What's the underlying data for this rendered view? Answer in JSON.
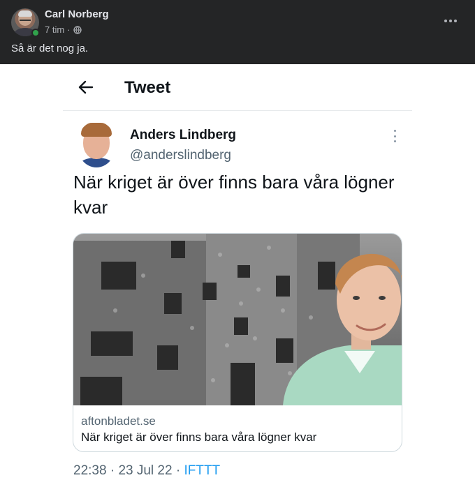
{
  "facebook_post": {
    "author": "Carl Norberg",
    "timestamp": "7 tim",
    "separator": "·",
    "audience_icon": "globe-icon",
    "more_icon": "more-options-icon",
    "text": "Så är det nog ja.",
    "online_status_color": "#31a24c"
  },
  "tweet_view": {
    "back_icon": "arrow-left-icon",
    "title": "Tweet",
    "author": {
      "name": "Anders Lindberg",
      "handle": "@anderslindberg"
    },
    "more_icon": "more-vertical-icon",
    "text": "När kriget är över finns bara våra lögner kvar",
    "link_card": {
      "domain": "aftonbladet.se",
      "title": "När kriget är över finns bara våra lögner kvar"
    },
    "footer": {
      "time": "22:38",
      "date": "23 Jul 22",
      "source": "IFTTT",
      "separator": "·"
    },
    "accent_color": "#1d9bf0"
  }
}
